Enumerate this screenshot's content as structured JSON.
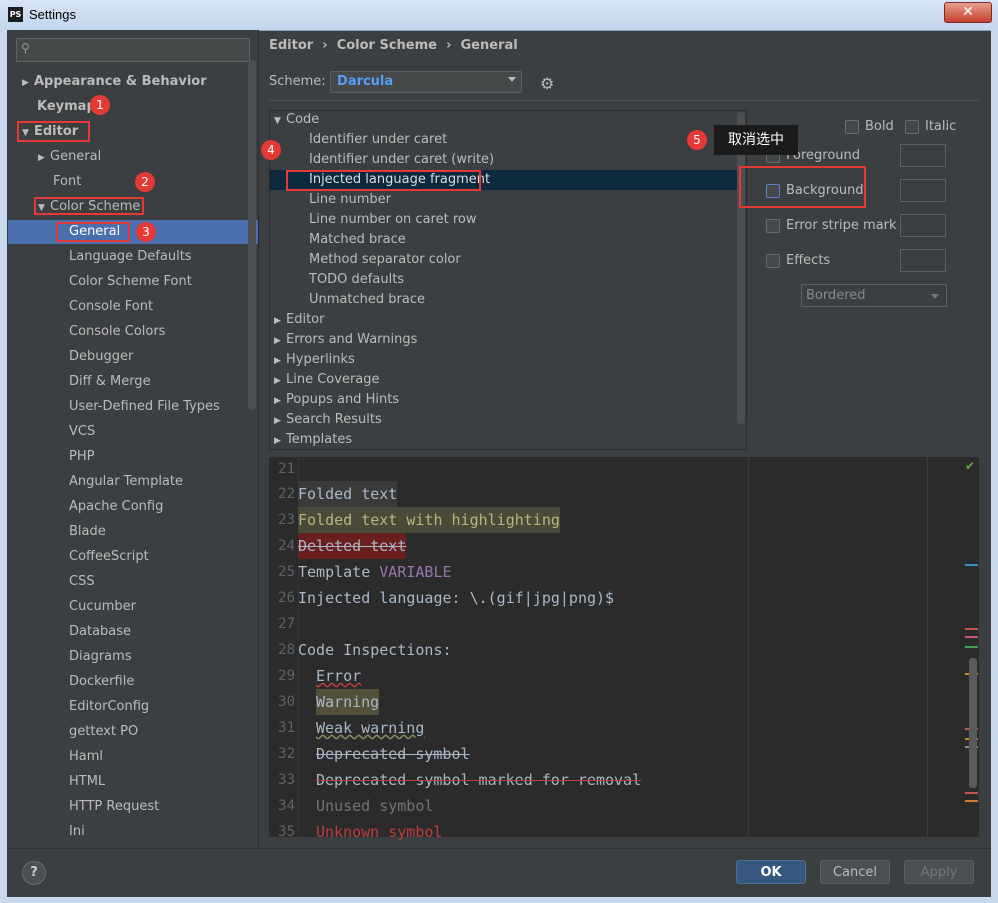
{
  "window": {
    "title": "Settings",
    "app_icon": "PS"
  },
  "search": {
    "placeholder": ""
  },
  "sidebar": {
    "items": [
      {
        "label": "Appearance & Behavior"
      },
      {
        "label": "Keymap"
      },
      {
        "label": "Editor"
      },
      {
        "label": "General"
      },
      {
        "label": "Font"
      },
      {
        "label": "Color Scheme"
      },
      {
        "label": "General"
      },
      {
        "label": "Language Defaults"
      },
      {
        "label": "Color Scheme Font"
      },
      {
        "label": "Console Font"
      },
      {
        "label": "Console Colors"
      },
      {
        "label": "Debugger"
      },
      {
        "label": "Diff & Merge"
      },
      {
        "label": "User-Defined File Types"
      },
      {
        "label": "VCS"
      },
      {
        "label": "PHP"
      },
      {
        "label": "Angular Template"
      },
      {
        "label": "Apache Config"
      },
      {
        "label": "Blade"
      },
      {
        "label": "CoffeeScript"
      },
      {
        "label": "CSS"
      },
      {
        "label": "Cucumber"
      },
      {
        "label": "Database"
      },
      {
        "label": "Diagrams"
      },
      {
        "label": "Dockerfile"
      },
      {
        "label": "EditorConfig"
      },
      {
        "label": "gettext PO"
      },
      {
        "label": "Haml"
      },
      {
        "label": "HTML"
      },
      {
        "label": "HTTP Request"
      },
      {
        "label": "Ini"
      }
    ]
  },
  "annotations": {
    "n1": "1",
    "n2": "2",
    "n3": "3",
    "n4": "4",
    "n5": "5",
    "tooltip": "取消选中"
  },
  "breadcrumb": {
    "a": "Editor",
    "sep1": "›",
    "b": "Color Scheme",
    "sep2": "›",
    "c": "General"
  },
  "scheme": {
    "label": "Scheme:",
    "value": "Darcula"
  },
  "category_tree": {
    "code": "Code",
    "children": [
      "Identifier under caret",
      "Identifier under caret (write)",
      "Injected language fragment",
      "Line number",
      "Line number on caret row",
      "Matched brace",
      "Method separator color",
      "TODO defaults",
      "Unmatched brace"
    ],
    "groups": [
      "Editor",
      "Errors and Warnings",
      "Hyperlinks",
      "Line Coverage",
      "Popups and Hints",
      "Search Results",
      "Templates"
    ]
  },
  "options": {
    "bold": "Bold",
    "italic": "Italic",
    "foreground": "Foreground",
    "background": "Background",
    "error_stripe": "Error stripe mark",
    "effects": "Effects",
    "effect_type": "Bordered"
  },
  "preview": {
    "lines": [
      {
        "n": "21",
        "t": ""
      },
      {
        "n": "22",
        "t": "Folded text"
      },
      {
        "n": "23",
        "t": "Folded text with highlighting"
      },
      {
        "n": "24",
        "t": "Deleted text"
      },
      {
        "n": "25",
        "t": "Template ",
        "t2": "VARIABLE"
      },
      {
        "n": "26",
        "t": "Injected language: \\.(gif|jpg|png)$"
      },
      {
        "n": "27",
        "t": ""
      },
      {
        "n": "28",
        "t": "Code Inspections:"
      },
      {
        "n": "29",
        "t": "Error"
      },
      {
        "n": "30",
        "t": "Warning"
      },
      {
        "n": "31",
        "t": "Weak warning"
      },
      {
        "n": "32",
        "t": "Deprecated symbol"
      },
      {
        "n": "33",
        "t": "Deprecated symbol marked for removal"
      },
      {
        "n": "34",
        "t": "Unused symbol"
      },
      {
        "n": "35",
        "t": "Unknown symbol"
      }
    ]
  },
  "buttons": {
    "help": "?",
    "ok": "OK",
    "cancel": "Cancel",
    "apply": "Apply"
  },
  "colors": {
    "accent": "#4b6eaf",
    "annotation_red": "#e53935",
    "scheme_value": "#589df6"
  }
}
